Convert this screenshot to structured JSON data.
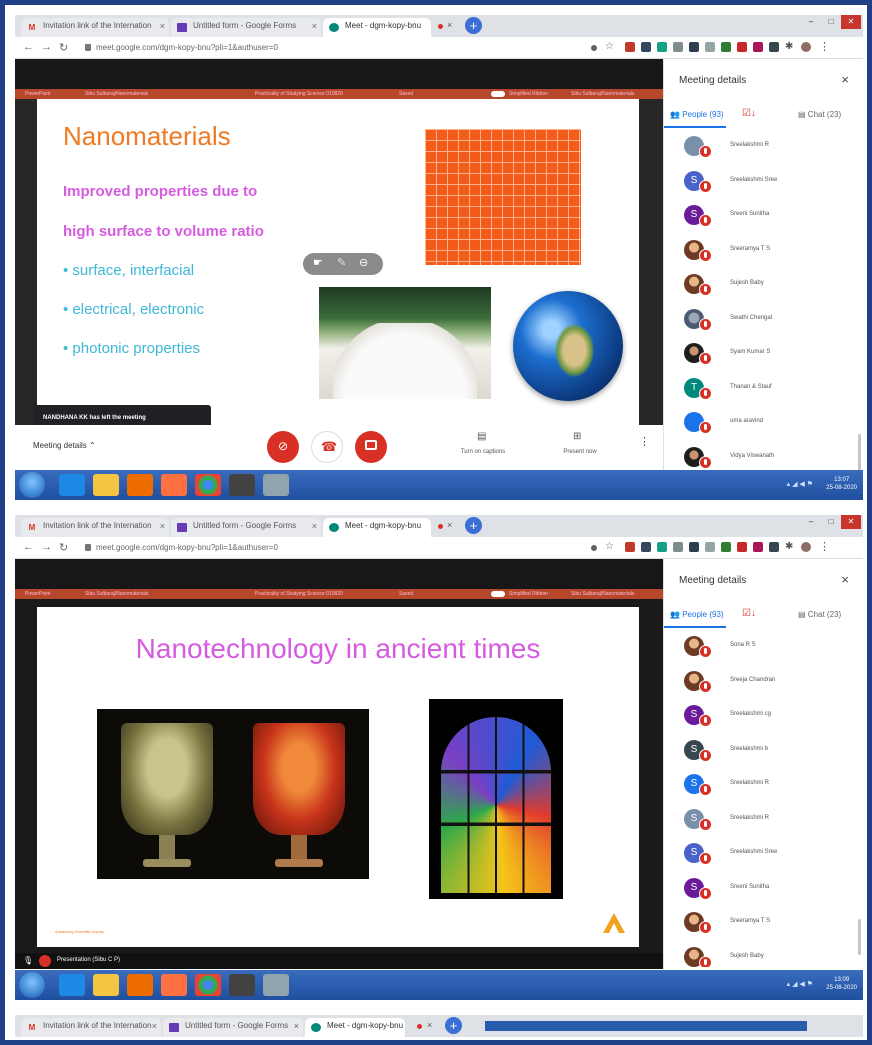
{
  "browser": {
    "tabs": [
      {
        "favicon": "gmail-icon",
        "label": "Invitation link of the Internation"
      },
      {
        "favicon": "forms-icon",
        "label": "Untitled form - Google Forms"
      },
      {
        "favicon": "meet-icon",
        "label": "Meet - dgm-kopy-bnu"
      }
    ],
    "address": "meet.google.com/dgm-kopy-bnu?pli=1&authuser=0",
    "tab_close": "×"
  },
  "ppt_bar": {
    "app": "PowerPoint",
    "author": "Sibu Sulbaraj/Nanomaterials",
    "title": "Practicality of Studying Science 010820",
    "mode": "Saved",
    "toggle_label": "Simplified Ribbon",
    "right": "Sibu Sulbaraj/Nanomaterials"
  },
  "meeting_panel": {
    "title": "Meeting details",
    "close": "×",
    "people_tab": "People (93)",
    "chat_tab": "Chat (23)"
  },
  "shot1": {
    "slide": {
      "title": "Nanomaterials",
      "subtitle_line1": "Improved properties due to",
      "subtitle_line2": "high surface to volume ratio",
      "bullets": [
        "• surface, interfacial",
        "• electrical, electronic",
        "• photonic properties"
      ]
    },
    "toast": "NANDHANA KK has left the meeting",
    "meeting_details_label": "Meeting details",
    "caption_btn": "Turn on captions",
    "present_btn": "Present now",
    "participants": [
      {
        "initial": "",
        "name": "Sreelakshmi R",
        "color": "#7a8fa8"
      },
      {
        "initial": "S",
        "name": "Sreelakshmi Sree",
        "color": "#4a63c9"
      },
      {
        "initial": "S",
        "name": "Sreeni Sunitha",
        "color": "#6a1b9a"
      },
      {
        "initial": "",
        "name": "Sreeramya T S",
        "photo": "photo"
      },
      {
        "initial": "",
        "name": "Sujesh Baby",
        "photo": "photo"
      },
      {
        "initial": "",
        "name": "Swathi Chengat",
        "photo": "photo3"
      },
      {
        "initial": "",
        "name": "Syam Kumar S",
        "photo": "photo2"
      },
      {
        "initial": "T",
        "name": "Thanan & Stauf",
        "color": "#00897b"
      },
      {
        "initial": "",
        "name": "uma aravind",
        "color": "#1a73e8"
      },
      {
        "initial": "",
        "name": "Vidya Viswanath",
        "photo": "photo2"
      }
    ],
    "clock_time": "13:07",
    "clock_date": "25-08-2020"
  },
  "shot2": {
    "slide": {
      "title": "Nanotechnology in ancient times",
      "footer": "Advancing Scientific Inquiry"
    },
    "presenting": "Presentation (Sibu C P)",
    "participants": [
      {
        "initial": "",
        "name": "Sona R S",
        "photo": "photo"
      },
      {
        "initial": "",
        "name": "Sreeja Chandran",
        "photo": "photo"
      },
      {
        "initial": "S",
        "name": "Sreelakshmi cg",
        "color": "#6a1b9a"
      },
      {
        "initial": "S",
        "name": "Sreelakshmi b",
        "color": "#37474f"
      },
      {
        "initial": "S",
        "name": "Sreelakshmi R",
        "color": "#1a73e8"
      },
      {
        "initial": "S",
        "name": "Sreelakshmi R",
        "color": "#7a8fa8"
      },
      {
        "initial": "S",
        "name": "Sreelakshmi Sree",
        "color": "#4a63c9"
      },
      {
        "initial": "S",
        "name": "Sreeni Sunitha",
        "color": "#6a1b9a"
      },
      {
        "initial": "",
        "name": "Sreeramya T S",
        "photo": "photo"
      },
      {
        "initial": "",
        "name": "Sujesh Baby",
        "photo": "photo"
      }
    ],
    "clock_time": "13:09",
    "clock_date": "25-08-2020"
  },
  "colors": {
    "frame": "#1f3f86",
    "ppt_bar": "#b7472a",
    "slide_title_orange": "#f07a22",
    "slide_magenta": "#d55be0",
    "slide_cyan": "#3fb7d6",
    "end_call": "#d93025",
    "taskbar": "#2a5cad"
  }
}
